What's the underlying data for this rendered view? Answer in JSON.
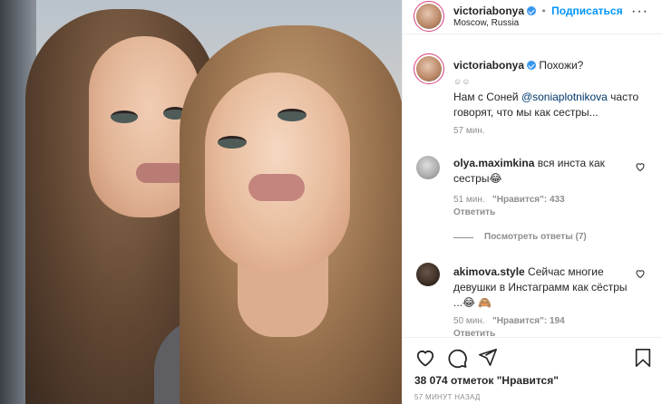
{
  "header": {
    "username": "victoriabonya",
    "dot": "•",
    "follow_label": "Подписаться",
    "location": "Moscow, Russia",
    "more_icon": "more-dots-icon"
  },
  "caption": {
    "username": "victoriabonya",
    "text_first": "Похожи?",
    "emoji_line": "☺☺",
    "text_before_mention": "Нам с Соней ",
    "mention": "@soniaplotnikova",
    "text_after_mention": " часто говорят, что мы как сестры...",
    "time": "57 мин."
  },
  "comments": [
    {
      "username": "olya.maximkina",
      "text": " вся инста как сестры😂",
      "time": "51 мин.",
      "likes": "\"Нравится\": 433",
      "reply": "Ответить"
    },
    {
      "username": "akimova.style",
      "text": " Сейчас многие девушки в Инстаграмм как сёстры ...😂 🙈",
      "time": "50 мин.",
      "likes": "\"Нравится\": 194",
      "reply": "Ответить"
    }
  ],
  "view_replies": "Посмотреть ответы (7)",
  "likes_summary": "38 074 отметок \"Нравится\"",
  "post_time": "57 МИНУТ НАЗАД",
  "icons": {
    "like": "heart-icon",
    "comment": "comment-icon",
    "share": "share-icon",
    "save": "bookmark-icon"
  }
}
